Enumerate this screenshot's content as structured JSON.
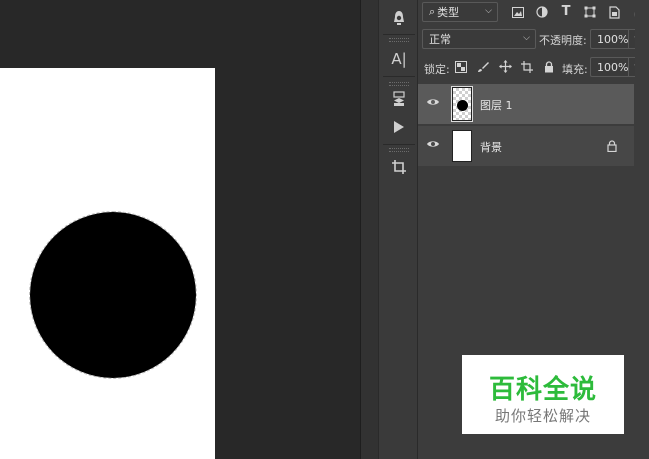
{
  "filter": {
    "kind_label": "类型"
  },
  "blend": {
    "mode": "正常",
    "opacity_label": "不透明度:",
    "opacity_value": "100%"
  },
  "lock": {
    "label": "锁定:",
    "fill_label": "填充:",
    "fill_value": "100%"
  },
  "layers": [
    {
      "name": "图层 1"
    },
    {
      "name": "背景"
    }
  ],
  "toolbar": {
    "text_tool": "A|"
  },
  "watermark": {
    "title": "百科全说",
    "subtitle": "助你轻松解决"
  },
  "colors": {
    "watermark_green": "#2dbb3b",
    "panel_bg": "#3c3c3c",
    "active_layer": "#5a5a5a"
  }
}
